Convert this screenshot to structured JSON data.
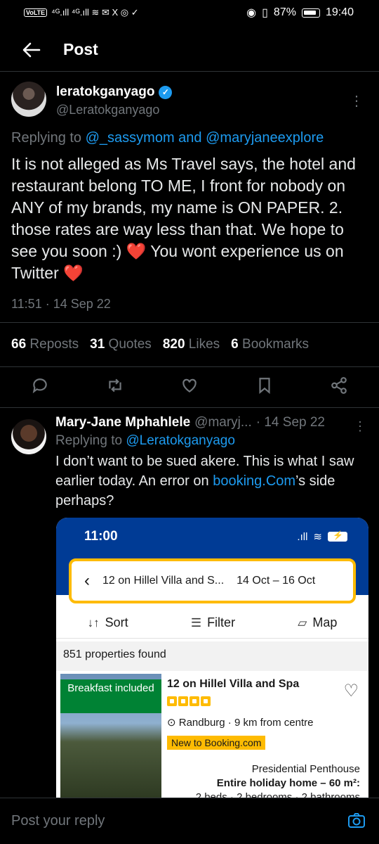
{
  "status_bar": {
    "volte": "VoLTE",
    "left_icons": "⁴ᴳ.ıll ⁴ᴳ.ıll ≋ ✉ X ◎ ✓",
    "battery": "87%",
    "time": "19:40"
  },
  "header": {
    "back_icon": "back-arrow-icon",
    "title": "Post"
  },
  "tweet": {
    "name": "leratokganyago",
    "handle": "@Leratokganyago",
    "replying_prefix": "Replying to ",
    "replying_to_1": "@_sassymom",
    "replying_and": " and ",
    "replying_to_2": "@maryjaneexplore",
    "text_1": "It is not alleged as Ms Travel says, the hotel and restaurant belong TO ME, I front for nobody on ANY of my brands, my name is ON PAPER. 2. those rates are way less than that. We hope to see you soon :) ",
    "heart_1": "❤️",
    "text_2": " You wont experience us on Twitter ",
    "heart_2": "❤️",
    "timestamp": "11:51 · 14 Sep 22",
    "stats": {
      "reposts_count": "66",
      "reposts_label": "Reposts",
      "quotes_count": "31",
      "quotes_label": "Quotes",
      "likes_count": "820",
      "likes_label": "Likes",
      "bookmarks_count": "6",
      "bookmarks_label": "Bookmarks"
    }
  },
  "reply": {
    "name": "Mary-Jane Mphahlele",
    "handle": "@maryj...",
    "date": "· 14 Sep 22",
    "replying_prefix": "Replying to ",
    "replying_to": "@Leratokganyago",
    "text_1": "I don’t want to be sued akere. This is what I saw earlier today. An error on ",
    "link": "booking.Com",
    "text_2": "’s side perhaps?"
  },
  "embed": {
    "time": "11:00",
    "search_text": "12 on Hillel Villa and S...",
    "dates": "14 Oct  –  16 Oct",
    "sort": "Sort",
    "filter": "Filter",
    "map": "Map",
    "found": "851 properties found",
    "badge": "Breakfast included",
    "hotel": "12 on Hillel Villa and Spa",
    "location": "Randburg · 9 km from centre",
    "new_badge": "New to Booking.com",
    "room_title": "Presidential Penthouse",
    "room_type": "Entire holiday home – 60 m²:",
    "room_details": "2 beds · 2 bedrooms · 2 bathrooms"
  },
  "composer": {
    "placeholder": "Post your reply",
    "camera_icon": "camera-icon"
  },
  "colors": {
    "accent": "#1d9bf0",
    "muted": "#71767b",
    "heart": "#f4212e",
    "booking_blue": "#003b95",
    "booking_yellow": "#febb02"
  }
}
